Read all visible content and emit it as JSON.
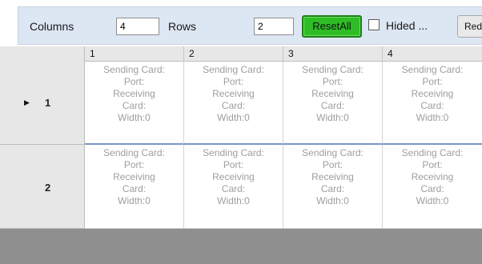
{
  "toolbar": {
    "columns_label": "Columns",
    "columns_value": "4",
    "rows_label": "Rows",
    "rows_value": "2",
    "reset_all_label": "ResetAll",
    "hided_label": "Hided ...",
    "red_label": "Red"
  },
  "grid": {
    "columns": [
      "1",
      "2",
      "3",
      "4"
    ],
    "rows": [
      {
        "label": "1",
        "current": true,
        "cells": [
          {
            "sending": "Sending Card:",
            "port": "Port:",
            "receiving1": "Receiving",
            "receiving2": "Card:",
            "width": "Width:0"
          },
          {
            "sending": "Sending Card:",
            "port": "Port:",
            "receiving1": "Receiving",
            "receiving2": "Card:",
            "width": "Width:0"
          },
          {
            "sending": "Sending Card:",
            "port": "Port:",
            "receiving1": "Receiving",
            "receiving2": "Card:",
            "width": "Width:0"
          },
          {
            "sending": "Sending Card:",
            "port": "Port:",
            "receiving1": "Receiving",
            "receiving2": "Card:",
            "width": "Width:0"
          }
        ]
      },
      {
        "label": "2",
        "current": false,
        "cells": [
          {
            "sending": "Sending Card:",
            "port": "Port:",
            "receiving1": "Receiving",
            "receiving2": "Card:",
            "width": "Width:0"
          },
          {
            "sending": "Sending Card:",
            "port": "Port:",
            "receiving1": "Receiving",
            "receiving2": "Card:",
            "width": "Width:0"
          },
          {
            "sending": "Sending Card:",
            "port": "Port:",
            "receiving1": "Receiving",
            "receiving2": "Card:",
            "width": "Width:0"
          },
          {
            "sending": "Sending Card:",
            "port": "Port:",
            "receiving1": "Receiving",
            "receiving2": "Card:",
            "width": "Width:0"
          }
        ]
      }
    ]
  },
  "icons": {
    "current_row": "row-pointer-icon"
  },
  "colors": {
    "reset_button": "#2ebd25",
    "toolbar_bg": "#dde6f3",
    "row_divider": "#7b94cc",
    "empty_area": "#8f8f8f"
  }
}
